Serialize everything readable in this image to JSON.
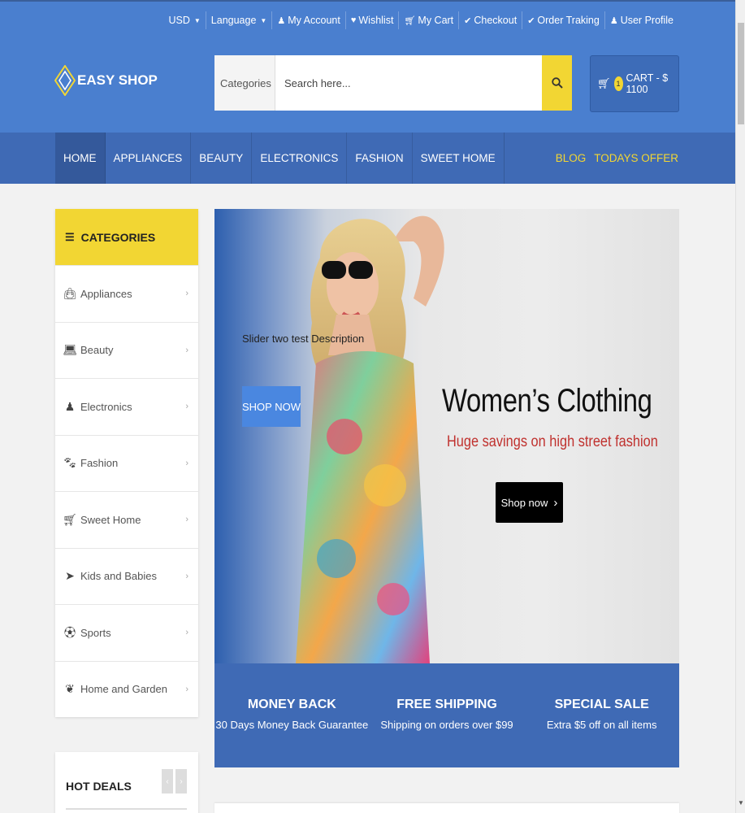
{
  "toplinks": {
    "currency": "USD",
    "language": "Language",
    "my_account": "My Account",
    "wishlist": "Wishlist",
    "my_cart": "My Cart",
    "checkout": "Checkout",
    "order_tracking": "Order Traking",
    "user_profile": "User Profile"
  },
  "logo": {
    "text": "EASY SHOP"
  },
  "search": {
    "category": "Categories",
    "placeholder": "Search here..."
  },
  "cart": {
    "count": "1",
    "label": "CART - $ 1100"
  },
  "nav": {
    "items": [
      "HOME",
      "APPLIANCES",
      "BEAUTY",
      "ELECTRONICS",
      "FASHION",
      "SWEET HOME"
    ],
    "right": [
      "BLOG",
      "TODAYS OFFER"
    ]
  },
  "sidebar": {
    "title": "CATEGORIES",
    "items": [
      {
        "label": "Appliances",
        "icon": "shopping-bag-icon"
      },
      {
        "label": "Beauty",
        "icon": "laptop-icon"
      },
      {
        "label": "Electronics",
        "icon": "user-icon"
      },
      {
        "label": "Fashion",
        "icon": "paw-icon"
      },
      {
        "label": "Sweet Home",
        "icon": "cart-icon"
      },
      {
        "label": "Kids and Babies",
        "icon": "paper-plane-icon"
      },
      {
        "label": "Sports",
        "icon": "soccer-ball-icon"
      },
      {
        "label": "Home and Garden",
        "icon": "leaf-icon"
      }
    ]
  },
  "hot_deals": {
    "title": "HOT DEALS"
  },
  "banner": {
    "description": "Slider two test Description",
    "shop_button": "SHOP NOW",
    "title": "Women’s Clothing",
    "subtitle": "Huge savings on high street fashion",
    "cta": "Shop now"
  },
  "features": [
    {
      "title": "MONEY BACK",
      "desc": "30 Days Money Back Guarantee"
    },
    {
      "title": "FREE SHIPPING",
      "desc": "Shipping on orders over $99"
    },
    {
      "title": "SPECIAL SALE",
      "desc": "Extra $5 off on all items"
    }
  ],
  "colors": {
    "header": "#4a7fcf",
    "nav": "#3f6ab5",
    "accent": "#f2d633",
    "promo_red": "#c0312e"
  }
}
